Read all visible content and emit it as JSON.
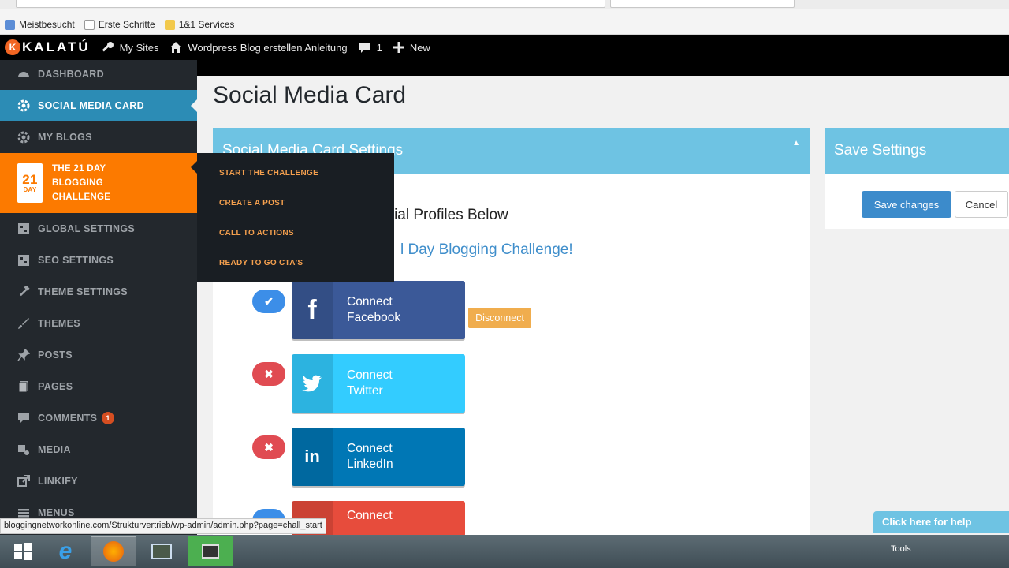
{
  "browser": {
    "bookmarks": [
      {
        "label": "Meistbesucht",
        "icon": "bookmark-icon"
      },
      {
        "label": "Erste Schritte",
        "icon": "page-icon"
      },
      {
        "label": "1&1 Services",
        "icon": "folder-icon"
      }
    ],
    "status_url": "bloggingnetworkonline.com/Strukturvertrieb/wp-admin/admin.php?page=chall_start"
  },
  "adminbar": {
    "logo_text": "KALATÚ",
    "my_sites": "My Sites",
    "site_name": "Wordpress Blog erstellen Anleitung",
    "comments_count": "1",
    "new_label": "New"
  },
  "sidebar": {
    "items": [
      {
        "label": "Dashboard",
        "icon": "dashboard-icon"
      },
      {
        "label": "Social Media Card",
        "icon": "gear-icon"
      },
      {
        "label": "My Blogs",
        "icon": "gear-icon"
      },
      {
        "label_lines": [
          "The 21 Day",
          "Blogging",
          "Challenge"
        ],
        "icon": "calendar-21-day-icon",
        "cal_number": "21",
        "cal_text": "DAY"
      },
      {
        "label": "Global Settings",
        "icon": "grid-icon"
      },
      {
        "label": "SEO Settings",
        "icon": "grid-icon"
      },
      {
        "label": "Theme Settings",
        "icon": "hammer-icon"
      },
      {
        "label": "Themes",
        "icon": "brush-icon"
      },
      {
        "label": "Posts",
        "icon": "pin-icon"
      },
      {
        "label": "Pages",
        "icon": "pages-icon"
      },
      {
        "label": "Comments",
        "icon": "comment-icon",
        "badge": "1"
      },
      {
        "label": "Media",
        "icon": "media-icon"
      },
      {
        "label": "Linkify",
        "icon": "link-icon"
      },
      {
        "label": "Menus",
        "icon": "menu-icon"
      }
    ]
  },
  "flyout": {
    "items": [
      "Start the Challenge",
      "Create a Post",
      "Call to Actions",
      "Ready to Go CTA's"
    ]
  },
  "main": {
    "page_title": "Social Media Card",
    "panel_title": "Social Media Card Settings",
    "subtitle": "ocial Profiles Below",
    "link_title": "l Day Blogging Challenge!",
    "connections": [
      {
        "line1": "Connect",
        "line2": "Facebook",
        "status": "connected",
        "color": "#3b5998",
        "icon": "facebook-icon"
      },
      {
        "line1": "Connect",
        "line2": "Twitter",
        "status": "disconnected",
        "color": "#33ccff",
        "icon": "twitter-icon"
      },
      {
        "line1": "Connect",
        "line2": "LinkedIn",
        "status": "disconnected",
        "color": "#0077b5",
        "icon": "linkedin-icon"
      },
      {
        "line1": "Connect",
        "line2": "",
        "status": "connected",
        "color": "#e74c3c",
        "icon": "google-plus-icon"
      }
    ],
    "disconnect_label": "Disconnect"
  },
  "save_panel": {
    "title": "Save Settings",
    "save_label": "Save changes",
    "cancel_label": "Cancel"
  },
  "help_label": "Click here for help",
  "taskbar": {
    "tools_label": "Tools"
  },
  "colors": {
    "sidebar_bg": "#23282d",
    "active_blue": "#2c8cb5",
    "challenge_orange": "#fc7a00",
    "panel_head_blue": "#6ec3e3"
  }
}
